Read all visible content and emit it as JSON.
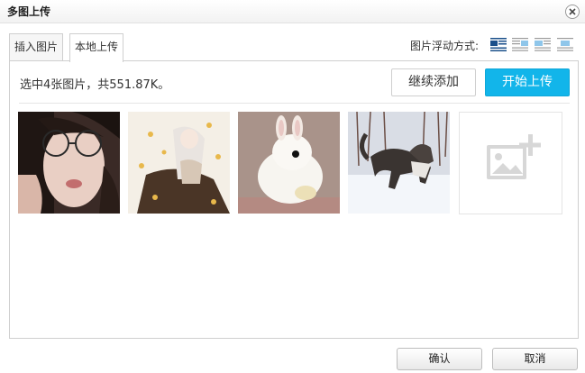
{
  "dialog": {
    "title": "多图上传"
  },
  "tabs": [
    {
      "label": "插入图片",
      "active": false
    },
    {
      "label": "本地上传",
      "active": true
    }
  ],
  "float_mode": {
    "label": "图片浮动方式:",
    "options": [
      {
        "icon": "align-left-icon",
        "selected": true
      },
      {
        "icon": "align-right-icon",
        "selected": false
      },
      {
        "icon": "align-none-icon",
        "selected": false
      },
      {
        "icon": "align-center-icon",
        "selected": false
      }
    ]
  },
  "upload": {
    "status_text": "选中4张图片，共551.87K。",
    "continue_label": "继续添加",
    "start_label": "开始上传",
    "accent": "#12b5ea",
    "images": [
      {
        "subject": "girl-with-glasses"
      },
      {
        "subject": "anime-girl-autumn"
      },
      {
        "subject": "white-rabbit"
      },
      {
        "subject": "dog-in-snow"
      }
    ],
    "add_icon": "add-image-icon"
  },
  "footer": {
    "ok_label": "确认",
    "cancel_label": "取消"
  }
}
